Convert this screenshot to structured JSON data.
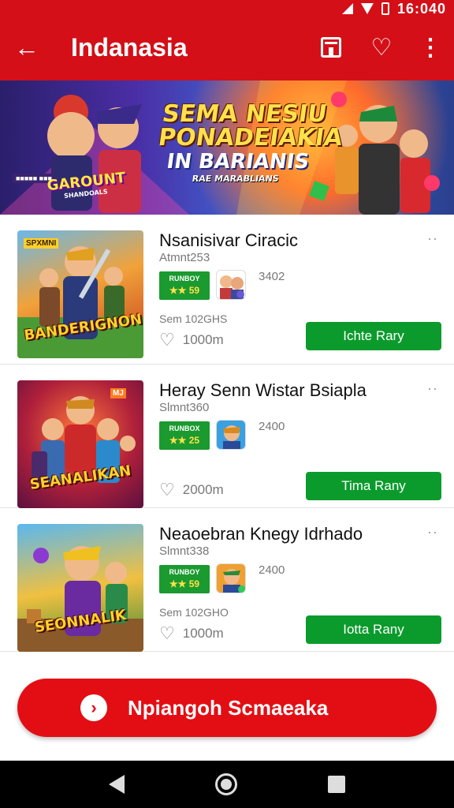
{
  "status": {
    "time": "16:040"
  },
  "appbar": {
    "title": "Indanasia",
    "back_icon": "arrow-left-icon",
    "actions": [
      "store-icon",
      "heart-icon",
      "more-vert-icon"
    ]
  },
  "banner": {
    "line1": "SEMA NESIU",
    "line2": "PONADEIAKIA",
    "line3": "IN BARIANIS",
    "line4": "RAE MARABLIANS",
    "logo": "GAROUNT",
    "logo_sub": "SHANDOALS",
    "badge": "■■■■■ ■■■"
  },
  "apps": [
    {
      "name": "Nsanisivar Ciracic",
      "developer": "Atmnt253",
      "rating_label": "RUNBOY",
      "rating_stars": "★★ 59",
      "count": "3402",
      "size": "Sem 102GHS",
      "likes": "1000m",
      "button": "Ichte Rary",
      "thumb_title": "BANDERIGNON",
      "thumb_tag": "SPXMNI"
    },
    {
      "name": "Heray Senn Wistar Bsiapla",
      "developer": "Slmnt360",
      "rating_label": "RUNBOX",
      "rating_stars": "★★ 25",
      "count": "2400",
      "size": "",
      "likes": "2000m",
      "button": "Tima Rany",
      "thumb_title": "SEANALIKAN",
      "thumb_tag": "MJ"
    },
    {
      "name": "Neaoebran Knegy Idrhado",
      "developer": "Slmnt338",
      "rating_label": "RUNBOY",
      "rating_stars": "★★ 59",
      "count": "2400",
      "size": "Sem 102GHO",
      "likes": "1000m",
      "button": "Iotta Rany",
      "thumb_title": "SEONNALIK",
      "thumb_tag": ""
    }
  ],
  "cta": {
    "label": "Npiangoh Scmaeaka",
    "icon": "chevron-right-icon"
  },
  "navbar": {
    "icons": [
      "nav-back-icon",
      "nav-home-icon",
      "nav-recent-icon"
    ]
  },
  "colors": {
    "primary": "#d40f17",
    "install": "#0b9b2c",
    "rating": "#1a9a2f"
  }
}
